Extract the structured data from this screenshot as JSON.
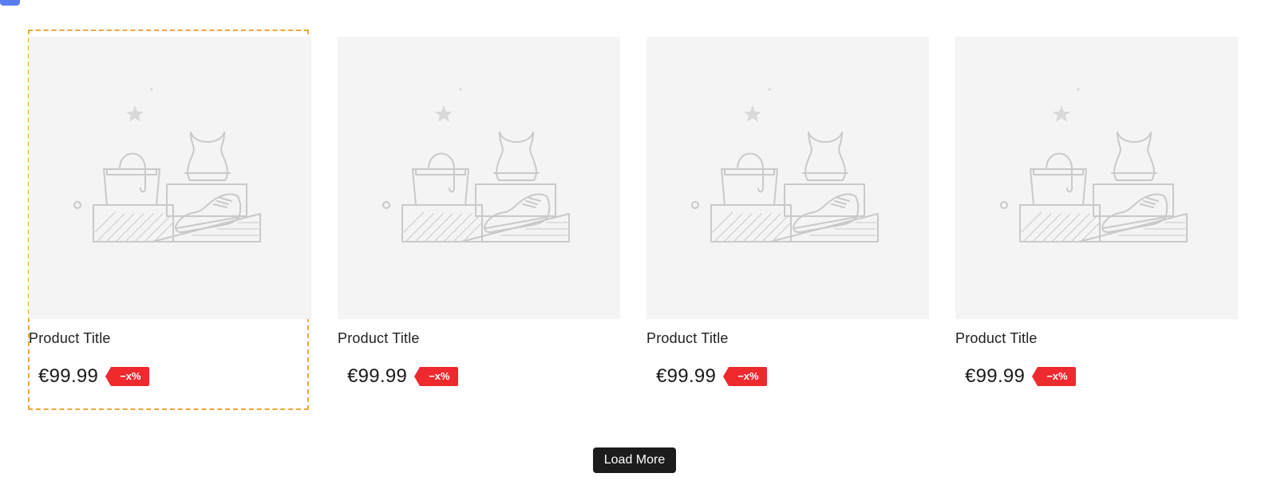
{
  "products": [
    {
      "title": "Product Title",
      "price": "€99.99",
      "badge": "−x%",
      "image_icon": "product-placeholder-icon"
    },
    {
      "title": "Product Title",
      "price": "€99.99",
      "badge": "−x%",
      "image_icon": "product-placeholder-icon"
    },
    {
      "title": "Product Title",
      "price": "€99.99",
      "badge": "−x%",
      "image_icon": "product-placeholder-icon"
    },
    {
      "title": "Product Title",
      "price": "€99.99",
      "badge": "−x%",
      "image_icon": "product-placeholder-icon"
    }
  ],
  "load_more_label": "Load More",
  "colors": {
    "image_bg": "#f4f4f4",
    "badge_bg": "#ee2a2f",
    "selection_outline": "#f0a640",
    "button_bg": "#1c1c1c",
    "corner_tab": "#5a7ef0"
  }
}
